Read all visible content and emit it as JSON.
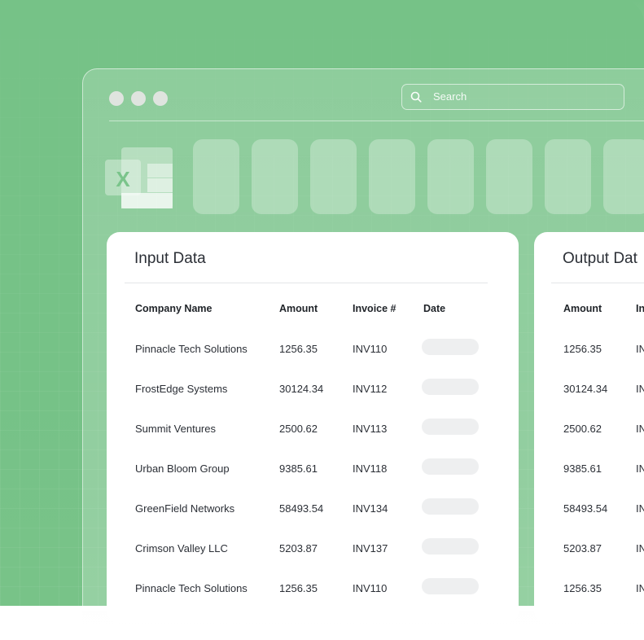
{
  "window": {
    "search": {
      "placeholder": "Search",
      "icon": "search-icon"
    },
    "app_icon": "excel-icon",
    "toolbar_tile_count": 8
  },
  "input_card": {
    "title": "Input Data",
    "columns": [
      "Company Name",
      "Amount",
      "Invoice #",
      "Date"
    ],
    "rows": [
      {
        "company": "Pinnacle Tech Solutions",
        "amount": "1256.35",
        "invoice": "INV110"
      },
      {
        "company": "FrostEdge Systems",
        "amount": "30124.34",
        "invoice": "INV112"
      },
      {
        "company": "Summit Ventures",
        "amount": "2500.62",
        "invoice": "INV113"
      },
      {
        "company": "Urban Bloom Group",
        "amount": "9385.61",
        "invoice": "INV118"
      },
      {
        "company": "GreenField Networks",
        "amount": "58493.54",
        "invoice": "INV134"
      },
      {
        "company": "Crimson Valley LLC",
        "amount": "5203.87",
        "invoice": "INV137"
      },
      {
        "company": "Pinnacle Tech Solutions",
        "amount": "1256.35",
        "invoice": "INV110"
      }
    ]
  },
  "output_card": {
    "title": "Output Dat",
    "columns": [
      "Amount",
      "In"
    ],
    "rows": [
      {
        "amount": "1256.35",
        "invoice": "IN"
      },
      {
        "amount": "30124.34",
        "invoice": "IN"
      },
      {
        "amount": "2500.62",
        "invoice": "IN"
      },
      {
        "amount": "9385.61",
        "invoice": "IN"
      },
      {
        "amount": "58493.54",
        "invoice": "IN"
      },
      {
        "amount": "5203.87",
        "invoice": "IN"
      },
      {
        "amount": "1256.35",
        "invoice": "IN"
      }
    ]
  },
  "colors": {
    "background": "#76c287",
    "card": "#ffffff",
    "date_placeholder": "#eeeff0",
    "text": "#2b2f36"
  }
}
